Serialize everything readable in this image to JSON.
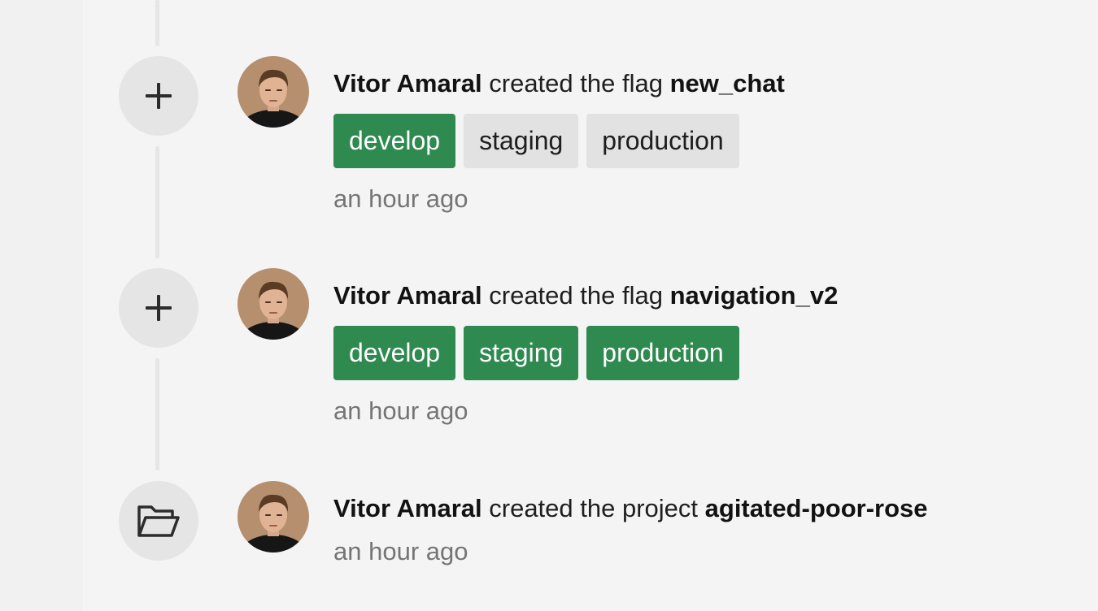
{
  "events": [
    {
      "icon": "plus-icon",
      "actor": "Vitor Amaral",
      "verb": "created the flag",
      "target": "new_chat",
      "environments": [
        {
          "label": "develop",
          "enabled": true
        },
        {
          "label": "staging",
          "enabled": false
        },
        {
          "label": "production",
          "enabled": false
        }
      ],
      "time": "an hour ago"
    },
    {
      "icon": "plus-icon",
      "actor": "Vitor Amaral",
      "verb": "created the flag",
      "target": "navigation_v2",
      "environments": [
        {
          "label": "develop",
          "enabled": true
        },
        {
          "label": "staging",
          "enabled": true
        },
        {
          "label": "production",
          "enabled": true
        }
      ],
      "time": "an hour ago"
    },
    {
      "icon": "folder-open-icon",
      "actor": "Vitor Amaral",
      "verb": "created the project",
      "target": "agitated-poor-rose",
      "time": "an hour ago"
    }
  ],
  "colors": {
    "env_enabled": "#2e8a4f",
    "env_disabled": "#e2e2e2"
  }
}
